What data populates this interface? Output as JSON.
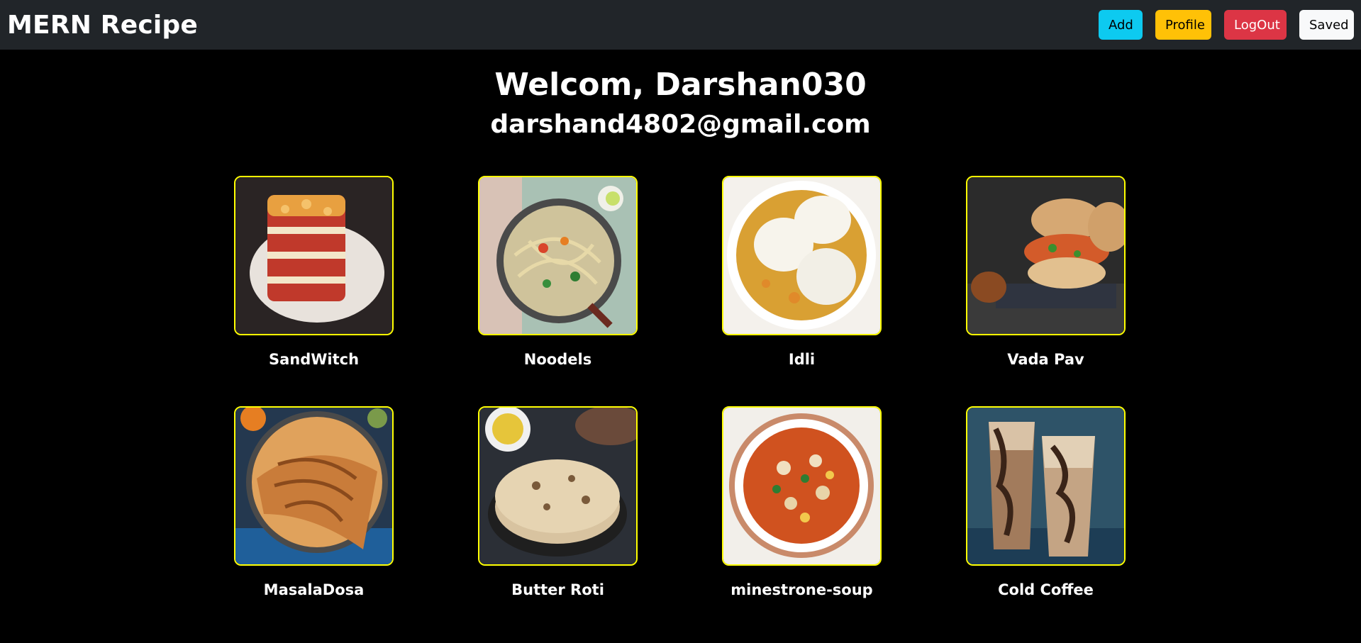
{
  "nav": {
    "brand": "MERN Recipe",
    "buttons": {
      "add": "Add",
      "profile": "Profile",
      "logout": "LogOut",
      "saved": "Saved"
    }
  },
  "welcome": {
    "greeting": "Welcom, Darshan030",
    "email": "darshand4802@gmail.com"
  },
  "recipes": [
    {
      "title": "SandWitch",
      "image": "lasagna-image"
    },
    {
      "title": "Noodels",
      "image": "noodles-image"
    },
    {
      "title": "Idli",
      "image": "idli-image"
    },
    {
      "title": "Vada Pav",
      "image": "vada-pav-image"
    },
    {
      "title": "MasalaDosa",
      "image": "masala-dosa-image"
    },
    {
      "title": "Butter Roti",
      "image": "butter-roti-image"
    },
    {
      "title": "minestrone-soup",
      "image": "minestrone-soup-image"
    },
    {
      "title": "Cold Coffee",
      "image": "cold-coffee-image"
    }
  ],
  "colors": {
    "navbar": "#212529",
    "background": "#000000",
    "card_border": "#ffff00",
    "add": "#0dcaf0",
    "profile": "#ffc107",
    "logout": "#dc3545",
    "saved": "#f8f9fa"
  }
}
